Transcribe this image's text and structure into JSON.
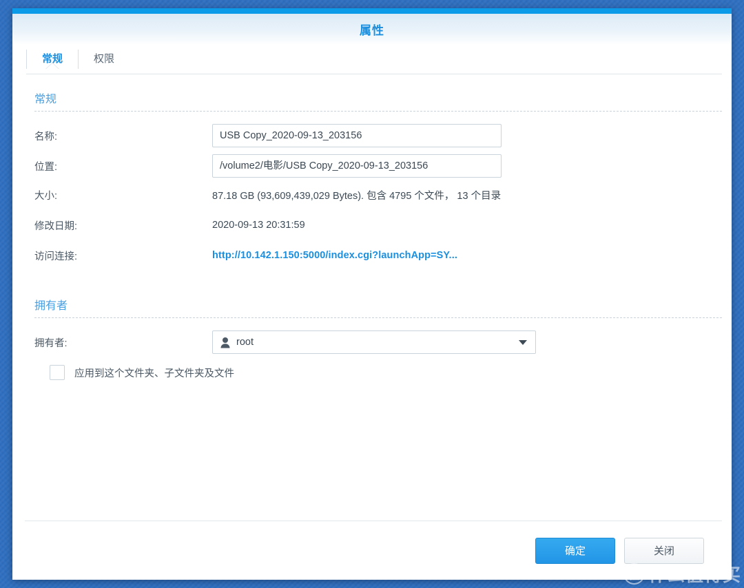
{
  "window": {
    "title": "属性"
  },
  "tabs": [
    {
      "label": "常规",
      "active": true
    },
    {
      "label": "权限",
      "active": false
    }
  ],
  "general_section": {
    "heading": "常规",
    "rows": {
      "name_label": "名称:",
      "name_value": "USB Copy_2020-09-13_203156",
      "location_label": "位置:",
      "location_value": "/volume2/电影/USB Copy_2020-09-13_203156",
      "size_label": "大小:",
      "size_value": "87.18 GB (93,609,439,029 Bytes). 包含 4795 个文件，  13 个目录",
      "modified_label": "修改日期:",
      "modified_value": "2020-09-13 20:31:59",
      "link_label": "访问连接:",
      "link_value": "http://10.142.1.150:5000/index.cgi?launchApp=SY..."
    }
  },
  "owner_section": {
    "heading": "拥有者",
    "owner_label": "拥有者:",
    "owner_value": "root",
    "owner_icon": "user-icon",
    "apply_checkbox_label": "应用到这个文件夹、子文件夹及文件",
    "apply_checked": false
  },
  "footer": {
    "ok_label": "确定",
    "close_label": "关闭"
  },
  "watermark": {
    "badge": "值",
    "text": "什么值得买"
  },
  "colors": {
    "accent": "#1a8fe0",
    "title_strip": "#0b9ae8",
    "section_heading": "#4a9fe0",
    "primary_button": "#2296e6",
    "desktop_background": "#2f6fc0"
  }
}
